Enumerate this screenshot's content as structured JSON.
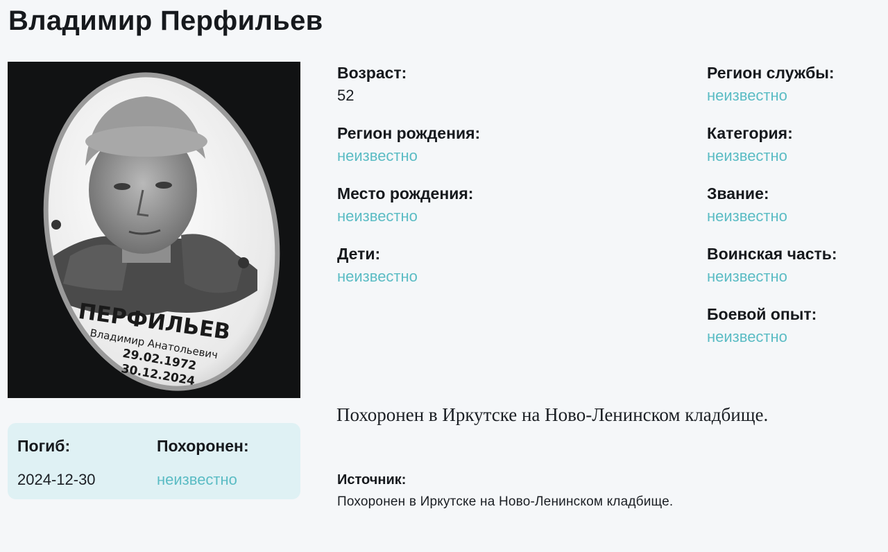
{
  "title": "Владимир Перфильев",
  "photo": {
    "plaque": {
      "surname": "ПЕРФИЛЬЕВ",
      "full_name": "Владимир Анатольевич",
      "birth_date": "29.02.1972",
      "death_date": "30.12.2024"
    }
  },
  "card": {
    "died_label": "Погиб:",
    "died_value": "2024-12-30",
    "buried_label": "Похоронен:",
    "buried_value": "неизвестно"
  },
  "left_fields": [
    {
      "label": "Возраст:",
      "value": "52"
    },
    {
      "label": "Регион рождения:",
      "value": "неизвестно"
    },
    {
      "label": "Место рождения:",
      "value": "неизвестно"
    },
    {
      "label": "Дети:",
      "value": "неизвестно"
    }
  ],
  "right_fields": [
    {
      "label": "Регион службы:",
      "value": "неизвестно"
    },
    {
      "label": "Категория:",
      "value": "неизвестно"
    },
    {
      "label": "Звание:",
      "value": "неизвестно"
    },
    {
      "label": "Воинская часть:",
      "value": "неизвестно"
    },
    {
      "label": "Боевой опыт:",
      "value": "неизвестно"
    }
  ],
  "burial_note": "Похоронен в Иркутске на Ново-Ленинском кладбище.",
  "source": {
    "label": "Источник:",
    "text": "Похоронен в Иркутске на Ново-Ленинском кладбище."
  },
  "colors": {
    "unknown_value": "#5bbcc4",
    "card_bg": "#dff1f4",
    "page_bg": "#f5f7f9"
  }
}
